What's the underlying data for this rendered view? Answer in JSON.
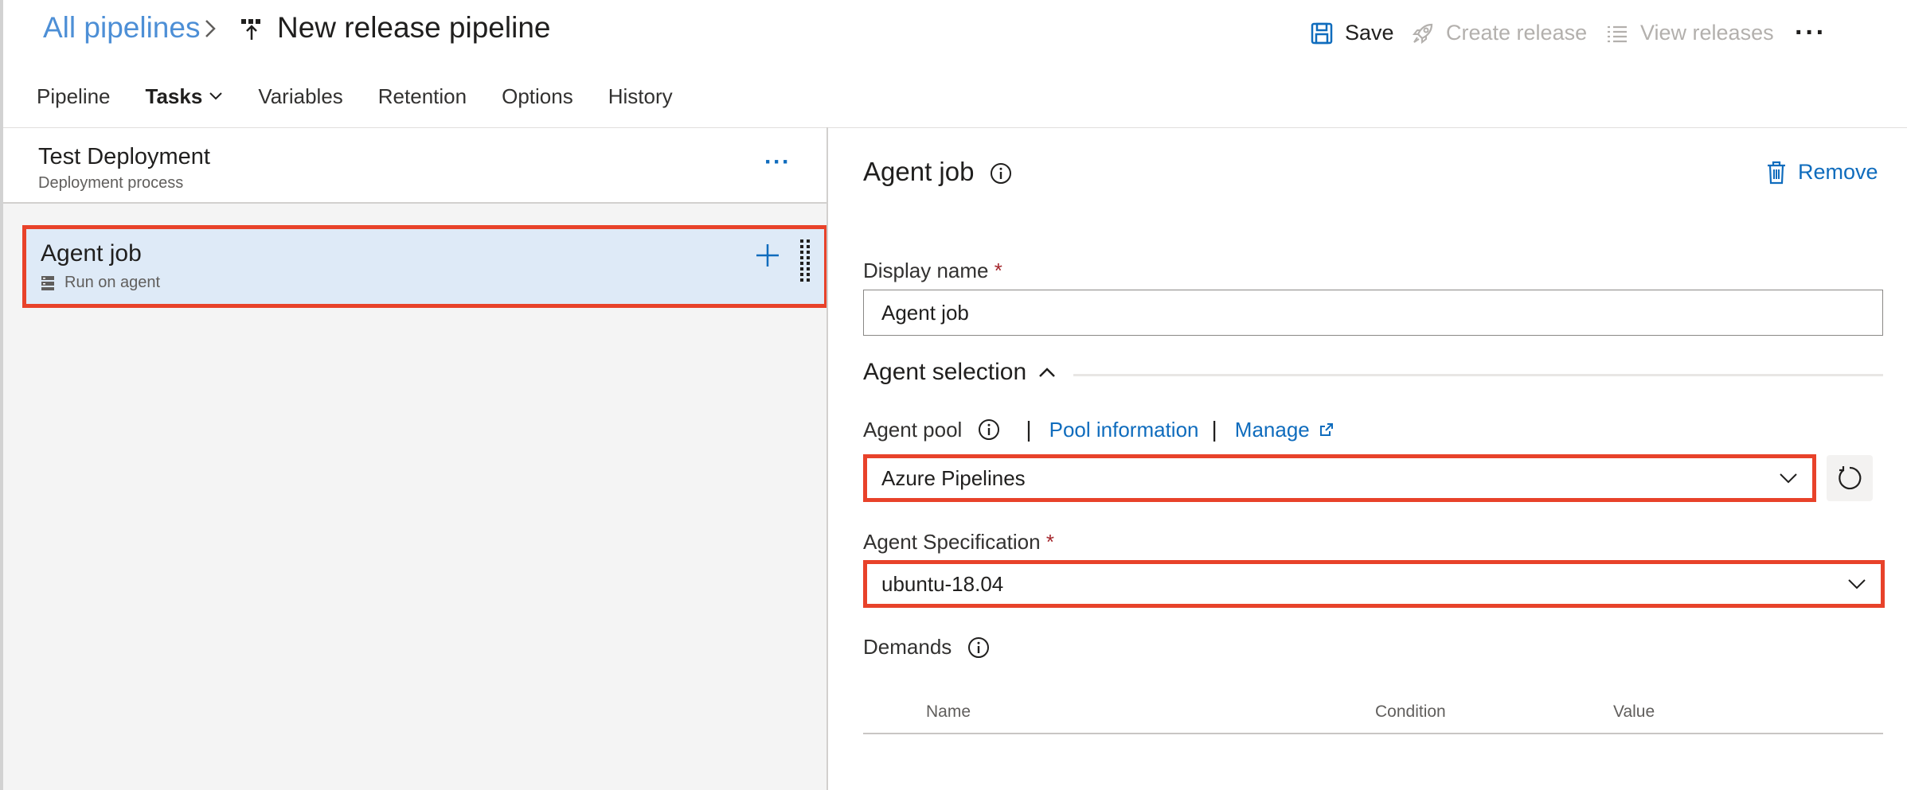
{
  "header": {
    "breadcrumb": "All pipelines",
    "title": "New release pipeline",
    "commands": {
      "save": "Save",
      "create_release": "Create release",
      "view_releases": "View releases",
      "more": "···"
    },
    "tabs": [
      {
        "label": "Pipeline"
      },
      {
        "label": "Tasks"
      },
      {
        "label": "Variables"
      },
      {
        "label": "Retention"
      },
      {
        "label": "Options"
      },
      {
        "label": "History"
      }
    ]
  },
  "stage": {
    "title": "Test Deployment",
    "subtitle": "Deployment process",
    "more": "···"
  },
  "job": {
    "title": "Agent job",
    "subtitle": "Run on agent"
  },
  "details": {
    "title": "Agent job",
    "remove_label": "Remove",
    "display_name_label": "Display name",
    "required_mark": "*",
    "display_name_value": "Agent job",
    "agent_selection_label": "Agent selection",
    "agent_pool_label": "Agent pool",
    "pool_information_link": "Pool information",
    "manage_link": "Manage",
    "agent_pool_value": "Azure Pipelines",
    "agent_spec_label": "Agent Specification",
    "agent_spec_value": "ubuntu-18.04",
    "demands_label": "Demands",
    "demands_columns": [
      "Name",
      "Condition",
      "Value"
    ]
  },
  "colors": {
    "accent": "#0f6cbd",
    "highlight_border": "#e8422a",
    "job_card_bg": "#deeaf7",
    "required": "#a4262c"
  }
}
